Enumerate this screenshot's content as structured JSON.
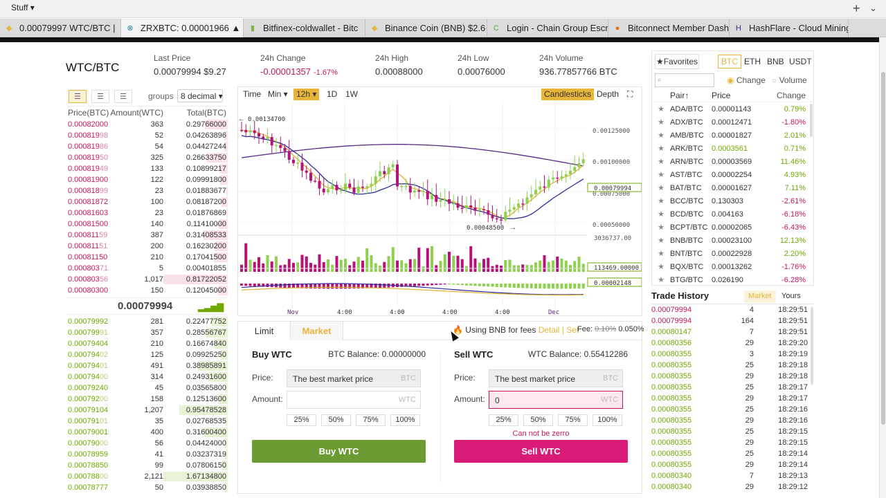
{
  "browser": {
    "bookmark": "Stuff",
    "tabs": [
      {
        "label": "0.00079997 WTC/BTC |",
        "icon": "binance-icon",
        "active": false
      },
      {
        "label": "ZRXBTC: 0.00001966 ▲",
        "icon": "zrx-icon",
        "active": true
      },
      {
        "label": "Bitfinex-coldwallet - Bitc",
        "icon": "bitfinex-icon",
        "active": false
      },
      {
        "label": "Binance Coin (BNB) $2.6",
        "icon": "binance-icon",
        "active": false
      },
      {
        "label": "Login - Chain Group Escr",
        "icon": "chain-icon",
        "active": false
      },
      {
        "label": "Bitconnect Member Dash",
        "icon": "bitconnect-icon",
        "active": false
      },
      {
        "label": "HashFlare - Cloud Mining",
        "icon": "hashflare-icon",
        "active": false
      }
    ]
  },
  "ticker": {
    "pair": "WTC/BTC",
    "last_price_label": "Last Price",
    "last_price": "0.00079994 $9.27",
    "change_label": "24h Change",
    "change_value": "-0.00001357",
    "change_pct": "-1.67%",
    "high_label": "24h High",
    "high_value": "0.00088000",
    "low_label": "24h Low",
    "low_value": "0.00076000",
    "volume_label": "24h Volume",
    "volume_value": "936.77857766 BTC"
  },
  "orderbook": {
    "groups_label": "groups",
    "groups_value": "8 decimal ▾",
    "headers": [
      "Price(BTC)",
      "Amount(WTC)",
      "Total(BTC)"
    ],
    "last_price": "0.00079994",
    "asks": [
      {
        "price_main": "0.00082000",
        "price_fade": "",
        "amount": "363",
        "total": "0.29766000",
        "depth": 0.36
      },
      {
        "price_main": "0.000819",
        "price_fade": "98",
        "amount": "52",
        "total": "0.04263896",
        "depth": 0.05
      },
      {
        "price_main": "0.000819",
        "price_fade": "86",
        "amount": "54",
        "total": "0.04427244",
        "depth": 0.05
      },
      {
        "price_main": "0.000819",
        "price_fade": "50",
        "amount": "325",
        "total": "0.26633750",
        "depth": 0.32
      },
      {
        "price_main": "0.000819",
        "price_fade": "49",
        "amount": "133",
        "total": "0.10899217",
        "depth": 0.13
      },
      {
        "price_main": "0.00081900",
        "price_fade": "",
        "amount": "122",
        "total": "0.09991800",
        "depth": 0.12
      },
      {
        "price_main": "0.000818",
        "price_fade": "99",
        "amount": "23",
        "total": "0.01883677",
        "depth": 0.02
      },
      {
        "price_main": "0.00081872",
        "price_fade": "",
        "amount": "100",
        "total": "0.08187200",
        "depth": 0.1
      },
      {
        "price_main": "0.00081603",
        "price_fade": "",
        "amount": "23",
        "total": "0.01876869",
        "depth": 0.02
      },
      {
        "price_main": "0.00081500",
        "price_fade": "",
        "amount": "140",
        "total": "0.11410000",
        "depth": 0.14
      },
      {
        "price_main": "0.000811",
        "price_fade": "59",
        "amount": "387",
        "total": "0.31408533",
        "depth": 0.38
      },
      {
        "price_main": "0.000811",
        "price_fade": "51",
        "amount": "200",
        "total": "0.16230200",
        "depth": 0.2
      },
      {
        "price_main": "0.00081150",
        "price_fade": "",
        "amount": "210",
        "total": "0.17041500",
        "depth": 0.21
      },
      {
        "price_main": "0.000803",
        "price_fade": "71",
        "amount": "5",
        "total": "0.00401855",
        "depth": 0.01
      },
      {
        "price_main": "0.000803",
        "price_fade": "56",
        "amount": "1,017",
        "total": "0.81722052",
        "depth": 1.0
      },
      {
        "price_main": "0.00080300",
        "price_fade": "",
        "amount": "150",
        "total": "0.12045000",
        "depth": 0.15
      }
    ],
    "bids": [
      {
        "price_main": "0.00079992",
        "price_fade": "",
        "amount": "281",
        "total": "0.22477752",
        "depth": 0.26
      },
      {
        "price_main": "0.000799",
        "price_fade": "91",
        "amount": "357",
        "total": "0.28556767",
        "depth": 0.33
      },
      {
        "price_main": "0.00079404",
        "price_fade": "",
        "amount": "210",
        "total": "0.16674840",
        "depth": 0.2
      },
      {
        "price_main": "0.000794",
        "price_fade": "02",
        "amount": "125",
        "total": "0.09925250",
        "depth": 0.12
      },
      {
        "price_main": "0.000794",
        "price_fade": "01",
        "amount": "491",
        "total": "0.38985891",
        "depth": 0.46
      },
      {
        "price_main": "0.000794",
        "price_fade": "00",
        "amount": "314",
        "total": "0.24931600",
        "depth": 0.3
      },
      {
        "price_main": "0.00079240",
        "price_fade": "",
        "amount": "45",
        "total": "0.03565800",
        "depth": 0.04
      },
      {
        "price_main": "0.000792",
        "price_fade": "00",
        "amount": "158",
        "total": "0.12513600",
        "depth": 0.15
      },
      {
        "price_main": "0.00079104",
        "price_fade": "",
        "amount": "1,207",
        "total": "0.95478528",
        "depth": 0.75
      },
      {
        "price_main": "0.000791",
        "price_fade": "01",
        "amount": "35",
        "total": "0.02768535",
        "depth": 0.03
      },
      {
        "price_main": "0.00079001",
        "price_fade": "",
        "amount": "400",
        "total": "0.31600400",
        "depth": 0.38
      },
      {
        "price_main": "0.000790",
        "price_fade": "00",
        "amount": "56",
        "total": "0.04424000",
        "depth": 0.05
      },
      {
        "price_main": "0.00078959",
        "price_fade": "",
        "amount": "41",
        "total": "0.03237319",
        "depth": 0.04
      },
      {
        "price_main": "0.00078850",
        "price_fade": "",
        "amount": "99",
        "total": "0.07806150",
        "depth": 0.09
      },
      {
        "price_main": "0.000788",
        "price_fade": "00",
        "amount": "2,121",
        "total": "1.67134800",
        "depth": 1.0
      },
      {
        "price_main": "0.00078777",
        "price_fade": "",
        "amount": "50",
        "total": "0.03938850",
        "depth": 0.05
      }
    ]
  },
  "chart": {
    "toolbar": {
      "time": "Time",
      "min": "Min ▾",
      "interval": "12h ▾",
      "d1": "1D",
      "w1": "1W",
      "candlesticks": "Candlesticks",
      "depth": "Depth"
    },
    "max_label": "0.00134700",
    "min_label": "0.00048500",
    "price_axis": [
      "0.00125000",
      "0.00100000",
      "0.00075000",
      "0.00050000"
    ],
    "current_price_tag": "0.00079994",
    "volume_max": "3036737.00",
    "volume_tag": "113469.00000",
    "macd_tag": "0.00002148",
    "x_labels": [
      "Nov",
      "4:00",
      "4:00",
      "4:00",
      "4:00",
      "Dec"
    ]
  },
  "trade": {
    "tab_limit": "Limit",
    "tab_market": "Market",
    "bnb_text": "Using BNB for fees",
    "bnb_detail": "Detail",
    "bnb_sep": "|",
    "bnb_set": "Set",
    "fee_label": "Fee:",
    "fee_old": "0.10%",
    "fee_new": "0.050%",
    "buy": {
      "title": "Buy WTC",
      "balance": "BTC Balance: 0.00000000",
      "price_label": "Price:",
      "price_value": "The best market price",
      "price_unit": "BTC",
      "amount_label": "Amount:",
      "amount_value": "",
      "amount_unit": "WTC",
      "pcts": [
        "25%",
        "50%",
        "75%",
        "100%"
      ],
      "button": "Buy WTC"
    },
    "sell": {
      "title": "Sell WTC",
      "balance": "WTC Balance: 0.55412286",
      "price_label": "Price:",
      "price_value": "The best market price",
      "price_unit": "BTC",
      "amount_label": "Amount:",
      "amount_value": "0",
      "amount_unit": "WTC",
      "pcts": [
        "25%",
        "50%",
        "75%",
        "100%"
      ],
      "error": "Can not be zerro",
      "button": "Sell WTC"
    }
  },
  "markets": {
    "favorites": "Favorites",
    "tabs": [
      "BTC",
      "ETH",
      "BNB",
      "USDT"
    ],
    "search_placeholder": "",
    "radio_change": "Change",
    "radio_volume": "Volume",
    "headers": [
      "Pair↑",
      "Price",
      "Change"
    ],
    "rows": [
      {
        "pair": "ADA/BTC",
        "price": "0.00001143",
        "change": "0.79%",
        "dir": "up"
      },
      {
        "pair": "ADX/BTC",
        "price": "0.00012471",
        "change": "-1.80%",
        "dir": "down"
      },
      {
        "pair": "AMB/BTC",
        "price": "0.00001827",
        "change": "2.01%",
        "dir": "up"
      },
      {
        "pair": "ARK/BTC",
        "price": "0.0003561",
        "change": "0.71%",
        "dir": "up"
      },
      {
        "pair": "ARN/BTC",
        "price": "0.00003569",
        "change": "11.46%",
        "dir": "up"
      },
      {
        "pair": "AST/BTC",
        "price": "0.00002254",
        "change": "4.93%",
        "dir": "up"
      },
      {
        "pair": "BAT/BTC",
        "price": "0.00001627",
        "change": "7.11%",
        "dir": "up"
      },
      {
        "pair": "BCC/BTC",
        "price": "0.130303",
        "change": "-2.61%",
        "dir": "down"
      },
      {
        "pair": "BCD/BTC",
        "price": "0.004163",
        "change": "-6.18%",
        "dir": "down"
      },
      {
        "pair": "BCPT/BTC",
        "price": "0.00002065",
        "change": "-6.43%",
        "dir": "down"
      },
      {
        "pair": "BNB/BTC",
        "price": "0.00023100",
        "change": "12.13%",
        "dir": "up"
      },
      {
        "pair": "BNT/BTC",
        "price": "0.00022928",
        "change": "2.20%",
        "dir": "up"
      },
      {
        "pair": "BQX/BTC",
        "price": "0.00013262",
        "change": "-1.76%",
        "dir": "down"
      },
      {
        "pair": "BTG/BTC",
        "price": "0.026190",
        "change": "-6.28%",
        "dir": "down"
      }
    ]
  },
  "history": {
    "title": "Trade History",
    "tab_market": "Market",
    "tab_yours": "Yours",
    "rows": [
      {
        "price": "0.00079994",
        "qty": "4",
        "time": "18:29:51",
        "dir": "down"
      },
      {
        "price": "0.00079994",
        "qty": "164",
        "time": "18:29:51",
        "dir": "down"
      },
      {
        "price": "0.00080147",
        "qty": "7",
        "time": "18:29:51",
        "dir": "up"
      },
      {
        "price": "0.00080356",
        "qty": "29",
        "time": "18:29:20",
        "dir": "up"
      },
      {
        "price": "0.00080355",
        "qty": "3",
        "time": "18:29:19",
        "dir": "up"
      },
      {
        "price": "0.00080355",
        "qty": "25",
        "time": "18:29:18",
        "dir": "up"
      },
      {
        "price": "0.00080355",
        "qty": "29",
        "time": "18:29:18",
        "dir": "up"
      },
      {
        "price": "0.00080355",
        "qty": "25",
        "time": "18:29:17",
        "dir": "up"
      },
      {
        "price": "0.00080355",
        "qty": "29",
        "time": "18:29:17",
        "dir": "up"
      },
      {
        "price": "0.00080355",
        "qty": "25",
        "time": "18:29:16",
        "dir": "up"
      },
      {
        "price": "0.00080355",
        "qty": "29",
        "time": "18:29:16",
        "dir": "up"
      },
      {
        "price": "0.00080355",
        "qty": "25",
        "time": "18:29:15",
        "dir": "up"
      },
      {
        "price": "0.00080355",
        "qty": "29",
        "time": "18:29:15",
        "dir": "up"
      },
      {
        "price": "0.00080355",
        "qty": "25",
        "time": "18:29:14",
        "dir": "up"
      },
      {
        "price": "0.00080355",
        "qty": "29",
        "time": "18:29:14",
        "dir": "up"
      },
      {
        "price": "0.00080340",
        "qty": "7",
        "time": "18:29:13",
        "dir": "up"
      },
      {
        "price": "0.00080340",
        "qty": "29",
        "time": "18:29:12",
        "dir": "up"
      }
    ]
  },
  "colors": {
    "up": "#70a800",
    "down": "#c2185b",
    "accent": "#e9b43a",
    "buy": "#6c9a33",
    "sell": "#d91b77"
  }
}
